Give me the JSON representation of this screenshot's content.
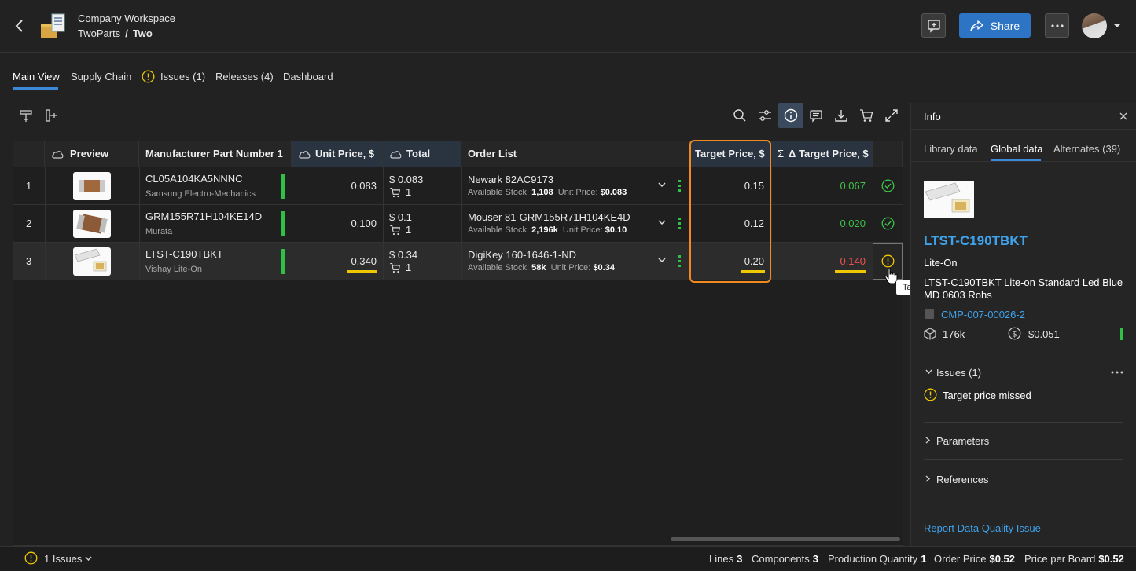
{
  "header": {
    "workspace": "Company Workspace",
    "project": "TwoParts",
    "separator": "/",
    "variant": "Two",
    "share_label": "Share"
  },
  "tabs": {
    "main_view": "Main View",
    "supply_chain": "Supply Chain",
    "issues": "Issues (1)",
    "releases": "Releases (4)",
    "dashboard": "Dashboard"
  },
  "table": {
    "headers": {
      "preview": "Preview",
      "mpn": "Manufacturer Part Number 1",
      "unit_price": "Unit Price, $",
      "total": "Total",
      "order_list": "Order List",
      "target_price": "Target Price, $",
      "delta_target": "Δ Target Price, $",
      "sigma": "Σ"
    },
    "labels": {
      "available_stock": "Available Stock:",
      "unit_price": "Unit Price:"
    },
    "rows": [
      {
        "index": "1",
        "mpn": "CL05A104KA5NNNC",
        "manufacturer": "Samsung Electro-Mechanics",
        "unit_price": "0.083",
        "total": "$ 0.083",
        "qty": "1",
        "supplier": "Newark 82AC9173",
        "stock": "1,108",
        "supplier_price": "$0.083",
        "target": "0.15",
        "delta": "0.067",
        "status": "ok"
      },
      {
        "index": "2",
        "mpn": "GRM155R71H104KE14D",
        "manufacturer": "Murata",
        "unit_price": "0.100",
        "total": "$ 0.1",
        "qty": "1",
        "supplier": "Mouser 81-GRM155R71H104KE4D",
        "stock": "2,196k",
        "supplier_price": "$0.10",
        "target": "0.12",
        "delta": "0.020",
        "status": "ok"
      },
      {
        "index": "3",
        "mpn": "LTST-C190TBKT",
        "manufacturer": "Vishay Lite-On",
        "unit_price": "0.340",
        "total": "$ 0.34",
        "qty": "1",
        "supplier": "DigiKey 160-1646-1-ND",
        "stock": "58k",
        "supplier_price": "$0.34",
        "target": "0.20",
        "delta": "-0.140",
        "status": "warning"
      }
    ],
    "tooltip": "Target price missed"
  },
  "info": {
    "title": "Info",
    "tabs": {
      "library": "Library data",
      "global": "Global data",
      "alternates": "Alternates (39)"
    },
    "part_name": "LTST-C190TBKT",
    "manufacturer": "Lite-On",
    "description_line1": "LTST-C190TBKT Lite-on Standard Led Blue",
    "description_line2": "MD 0603 Rohs",
    "cmp_id": "CMP-007-00026-2",
    "stock": "176k",
    "price": "$0.051",
    "issues_header": "Issues (1)",
    "issue_text": "Target price missed",
    "parameters": "Parameters",
    "references": "References",
    "report_link": "Report Data Quality Issue"
  },
  "footer": {
    "issues": "1 Issues",
    "lines_label": "Lines",
    "lines": "3",
    "components_label": "Components",
    "components": "3",
    "production_label": "Production Quantity",
    "production": "1",
    "order_price_label": "Order Price",
    "order_price": "$0.52",
    "per_board_label": "Price per Board",
    "per_board": "$0.52"
  },
  "colors": {
    "accent": "#3b89d8",
    "highlight": "#f08a1e",
    "ok": "#3fc24a",
    "warning": "#f0c800",
    "negative": "#f05050"
  }
}
